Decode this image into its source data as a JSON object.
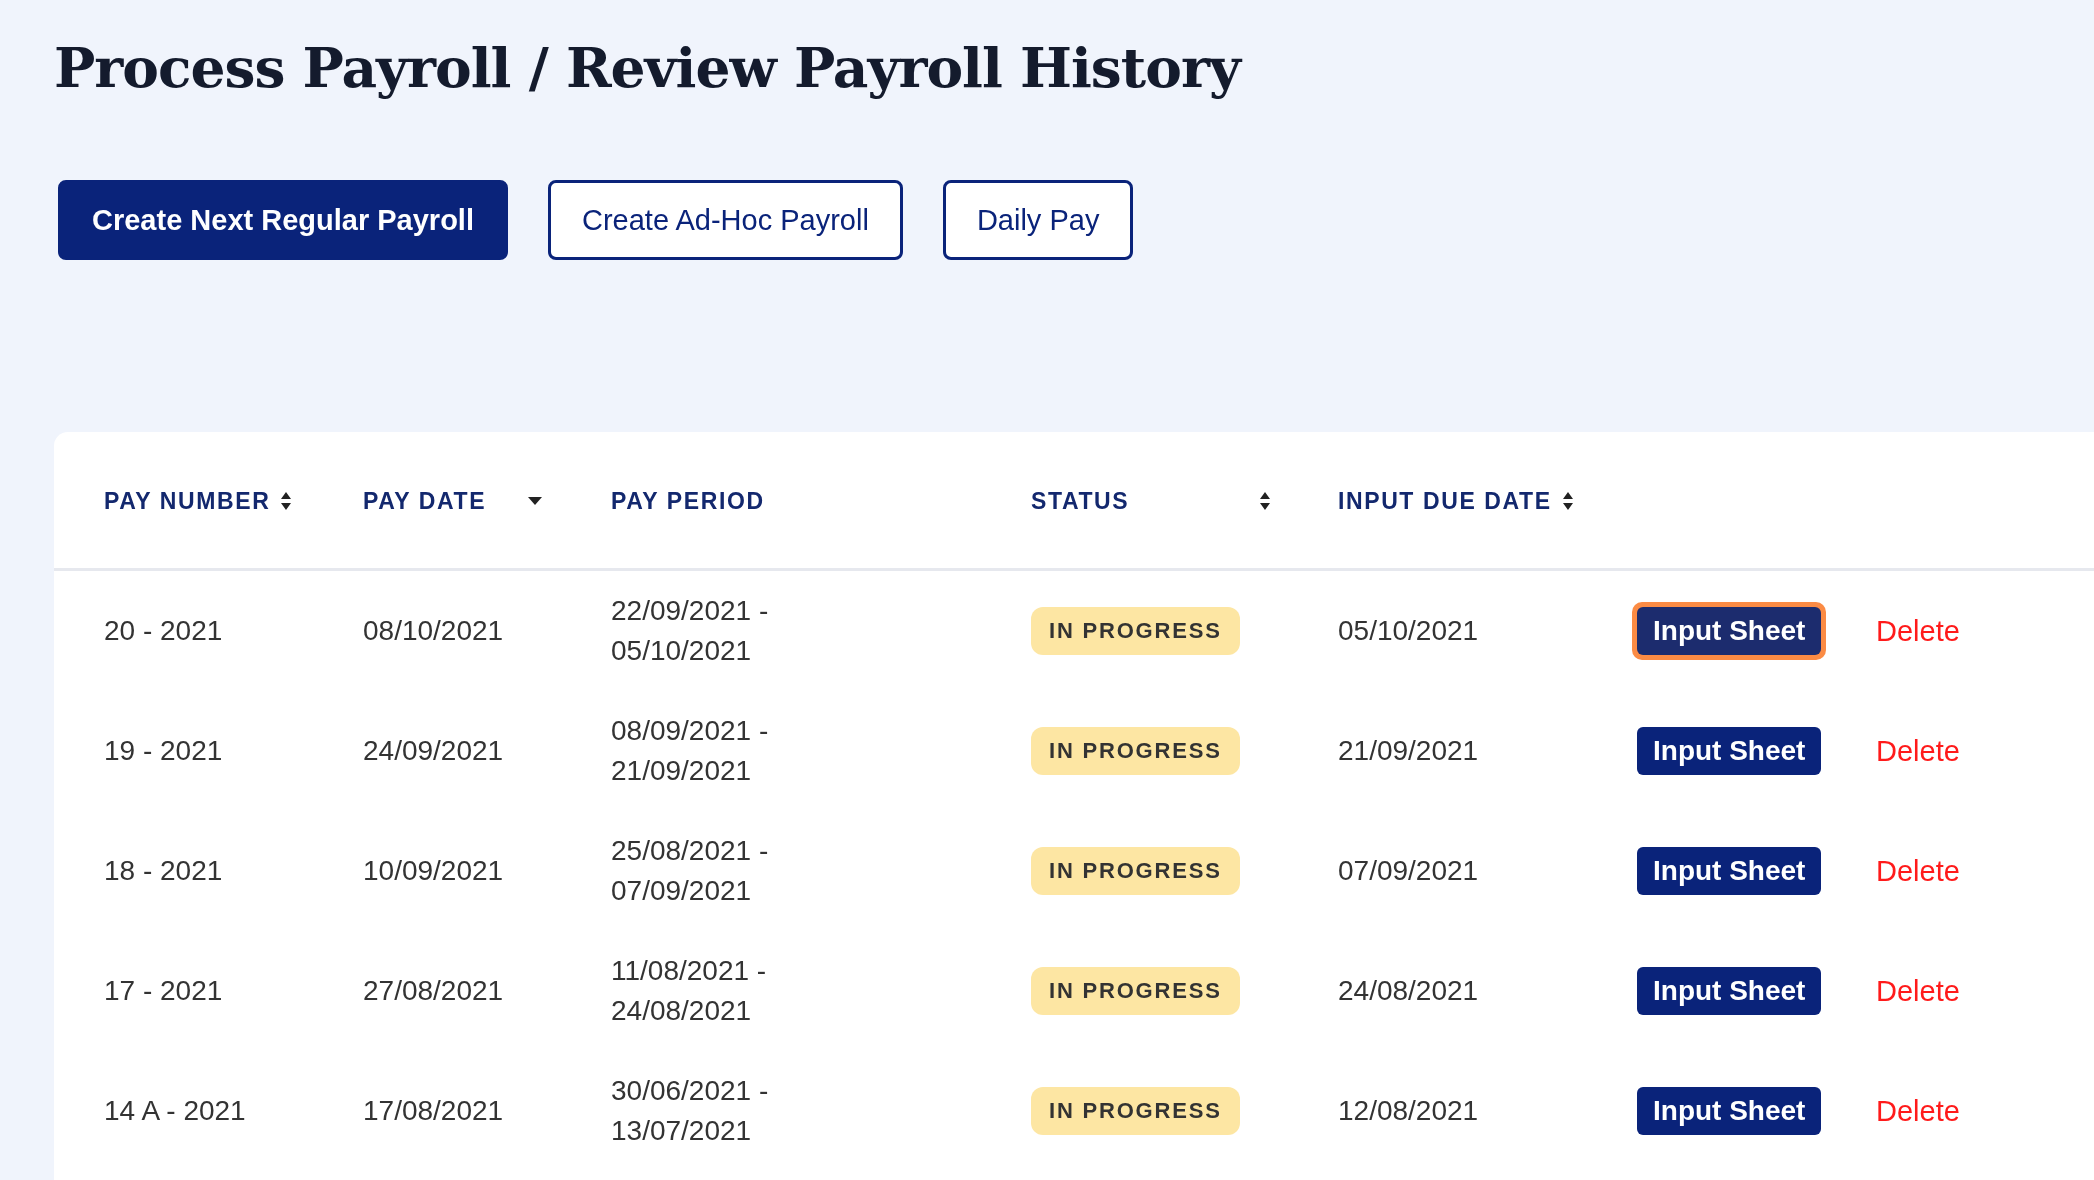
{
  "title": "Process Payroll / Review Payroll History",
  "actions": [
    {
      "label": "Create Next Regular Payroll",
      "kind": "primary"
    },
    {
      "label": "Create Ad-Hoc Payroll",
      "kind": "outline"
    },
    {
      "label": "Daily Pay",
      "kind": "outline"
    }
  ],
  "table": {
    "columns": [
      {
        "label": "PAY NUMBER",
        "kind": "sortable"
      },
      {
        "label": "PAY DATE",
        "kind": "sorted"
      },
      {
        "label": "PAY PERIOD",
        "kind": "plain"
      },
      {
        "label": "STATUS",
        "kind": "sortable"
      },
      {
        "label": "INPUT DUE DATE",
        "kind": "sortable"
      }
    ],
    "rows": [
      {
        "pay_number": "20 - 2021",
        "pay_date": "08/10/2021",
        "period_start": "22/09/2021 -",
        "period_end": "05/10/2021",
        "status": "IN PROGRESS",
        "due_date": "05/10/2021",
        "input_button": "Input Sheet",
        "focused": true,
        "delete": "Delete"
      },
      {
        "pay_number": "19 - 2021",
        "pay_date": "24/09/2021",
        "period_start": "08/09/2021 -",
        "period_end": "21/09/2021",
        "status": "IN PROGRESS",
        "due_date": "21/09/2021",
        "input_button": "Input Sheet",
        "focused": false,
        "delete": "Delete"
      },
      {
        "pay_number": "18 - 2021",
        "pay_date": "10/09/2021",
        "period_start": "25/08/2021 -",
        "period_end": "07/09/2021",
        "status": "IN PROGRESS",
        "due_date": "07/09/2021",
        "input_button": "Input Sheet",
        "focused": false,
        "delete": "Delete"
      },
      {
        "pay_number": "17 - 2021",
        "pay_date": "27/08/2021",
        "period_start": "11/08/2021 -",
        "period_end": "24/08/2021",
        "status": "IN PROGRESS",
        "due_date": "24/08/2021",
        "input_button": "Input Sheet",
        "focused": false,
        "delete": "Delete"
      },
      {
        "pay_number": "14 A - 2021",
        "pay_date": "17/08/2021",
        "period_start": "30/06/2021 -",
        "period_end": "13/07/2021",
        "status": "IN PROGRESS",
        "due_date": "12/08/2021",
        "input_button": "Input Sheet",
        "focused": false,
        "delete": "Delete"
      }
    ]
  }
}
